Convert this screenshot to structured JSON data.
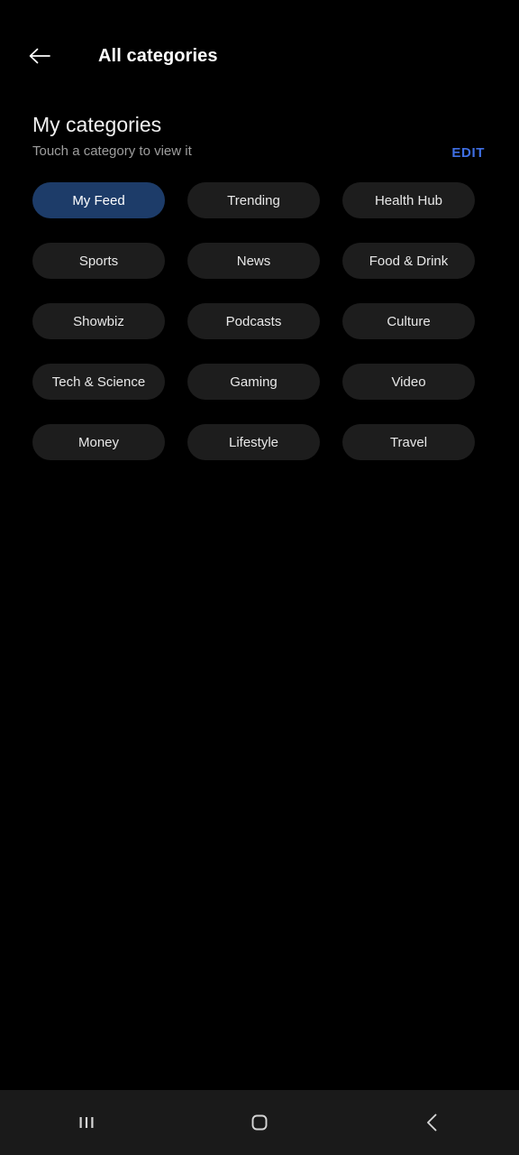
{
  "appbar": {
    "back_icon": "arrow-left-icon",
    "title": "All categories"
  },
  "section": {
    "title": "My categories",
    "subtitle": "Touch a category to view it",
    "edit_label": "EDIT"
  },
  "categories": [
    {
      "label": "My Feed",
      "selected": true
    },
    {
      "label": "Trending",
      "selected": false
    },
    {
      "label": "Health Hub",
      "selected": false
    },
    {
      "label": "Sports",
      "selected": false
    },
    {
      "label": "News",
      "selected": false
    },
    {
      "label": "Food & Drink",
      "selected": false
    },
    {
      "label": "Showbiz",
      "selected": false
    },
    {
      "label": "Podcasts",
      "selected": false
    },
    {
      "label": "Culture",
      "selected": false
    },
    {
      "label": "Tech & Science",
      "selected": false
    },
    {
      "label": "Gaming",
      "selected": false
    },
    {
      "label": "Video",
      "selected": false
    },
    {
      "label": "Money",
      "selected": false
    },
    {
      "label": "Lifestyle",
      "selected": false
    },
    {
      "label": "Travel",
      "selected": false
    }
  ],
  "navbar": {
    "recents_icon": "recents-icon",
    "home_icon": "home-icon",
    "back_icon": "chevron-left-icon"
  },
  "colors": {
    "background": "#000000",
    "chip": "#1d1d1d",
    "chip_selected": "#1d3c69",
    "accent": "#3f6fe4",
    "navbar": "#1a1a1a",
    "text_primary": "#f2f2f2",
    "text_secondary": "#9e9e9e"
  }
}
